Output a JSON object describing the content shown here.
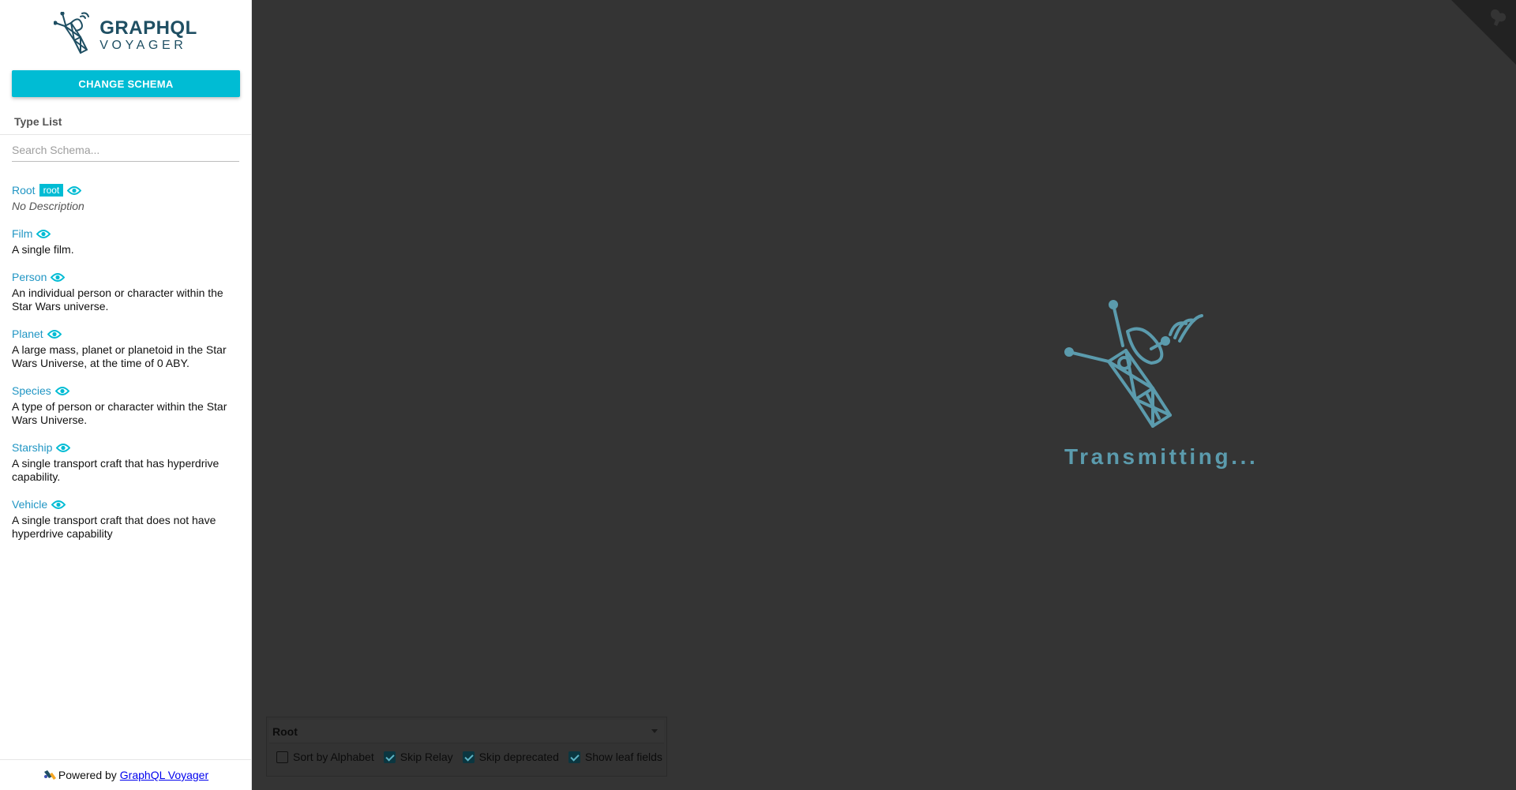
{
  "sidebar": {
    "logo": {
      "line1": "GRAPHQL",
      "line2": "VOYAGER"
    },
    "change_schema_label": "CHANGE SCHEMA",
    "type_list_title": "Type List",
    "search": {
      "placeholder": "Search Schema...",
      "value": ""
    },
    "types": [
      {
        "name": "Root",
        "badge": "root",
        "description": "No Description",
        "no_description": true
      },
      {
        "name": "Film",
        "badge": "",
        "description": "A single film.",
        "no_description": false
      },
      {
        "name": "Person",
        "badge": "",
        "description": "An individual person or character within the Star Wars universe.",
        "no_description": false
      },
      {
        "name": "Planet",
        "badge": "",
        "description": "A large mass, planet or planetoid in the Star Wars Universe, at the time of 0 ABY.",
        "no_description": false
      },
      {
        "name": "Species",
        "badge": "",
        "description": "A type of person or character within the Star Wars Universe.",
        "no_description": false
      },
      {
        "name": "Starship",
        "badge": "",
        "description": "A single transport craft that has hyperdrive capability.",
        "no_description": false
      },
      {
        "name": "Vehicle",
        "badge": "",
        "description": "A single transport craft that does not have hyperdrive capability",
        "no_description": false
      }
    ],
    "powered_by": {
      "prefix": "Powered by",
      "link_text": "GraphQL Voyager"
    }
  },
  "main": {
    "loading_text": "Transmitting...",
    "settings": {
      "root_select_value": "Root",
      "options": [
        {
          "label": "Sort by Alphabet",
          "checked": false
        },
        {
          "label": "Skip Relay",
          "checked": true
        },
        {
          "label": "Skip deprecated",
          "checked": true
        },
        {
          "label": "Show leaf fields",
          "checked": true
        }
      ]
    }
  },
  "colors": {
    "accent": "#00bcd4",
    "type_link": "#2196c4",
    "background": "#343434",
    "loader": "#5b9bad"
  },
  "icons": {
    "logo": "satellite-icon",
    "eye": "eye-icon",
    "corner": "github-corner-icon"
  }
}
